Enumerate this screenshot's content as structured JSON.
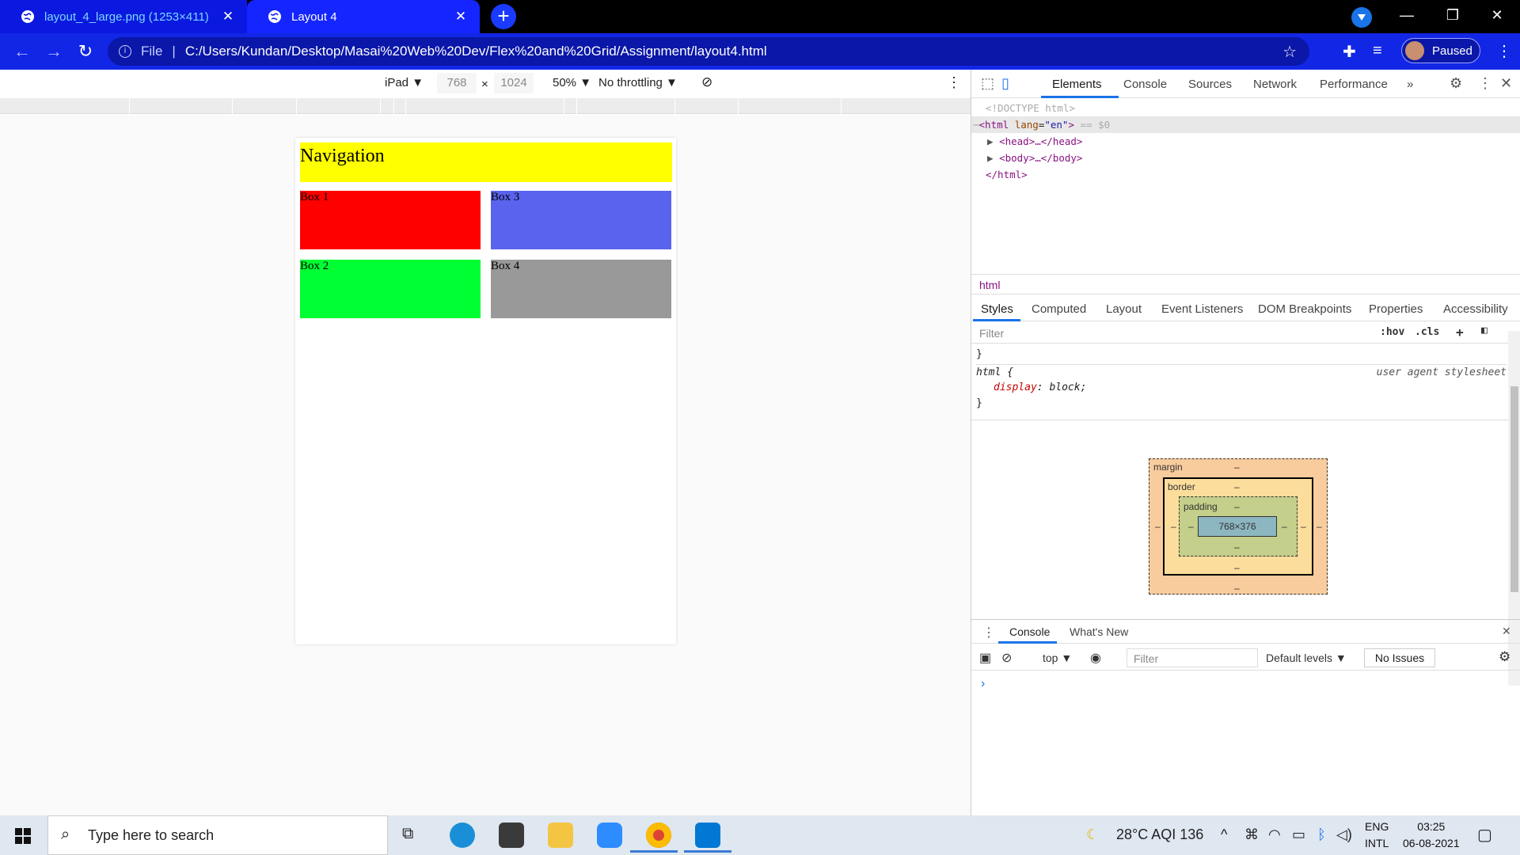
{
  "browser": {
    "tabs": [
      {
        "title": "layout_4_large.png (1253×411)",
        "active": false
      },
      {
        "title": "Layout 4",
        "active": true
      }
    ],
    "address": {
      "scheme_label": "File",
      "url": "C:/Users/Kundan/Desktop/Masai%20Web%20Dev/Flex%20and%20Grid/Assignment/layout4.html"
    },
    "profile_label": "Paused"
  },
  "device_toolbar": {
    "device": "iPad ▼",
    "width": "768",
    "times": "×",
    "height": "1024",
    "zoom": "50% ▼",
    "throttling": "No throttling ▼"
  },
  "page": {
    "nav_text": "Navigation",
    "boxes": [
      "Box 1",
      "Box 3",
      "Box 2",
      "Box 4"
    ],
    "colors": {
      "nav": "#ffff00",
      "box1": "#ff0000",
      "box3": "#5a63ee",
      "box2": "#00ff33",
      "box4": "#999999"
    }
  },
  "devtools": {
    "tabs": [
      "Elements",
      "Console",
      "Sources",
      "Network",
      "Performance",
      "»"
    ],
    "dom": {
      "doctype": "<!DOCTYPE html>",
      "html_open_tag": "<html",
      "lang_attr": "lang",
      "lang_value": "\"en\"",
      "selected_marker": "== $0",
      "head": "<head>…</head>",
      "body": "<body>…</body>",
      "html_close": "</html>"
    },
    "breadcrumb": "html",
    "style_tabs": [
      "Styles",
      "Computed",
      "Layout",
      "Event Listeners",
      "DOM Breakpoints",
      "Properties",
      "Accessibility"
    ],
    "filter_placeholder": "Filter",
    "filter_tools": [
      ":hov",
      ".cls",
      "+"
    ],
    "rules": {
      "close_brace": "}",
      "selector": "html {",
      "source": "user agent stylesheet",
      "property": "display",
      "value": "block;"
    },
    "box_model": {
      "margin_label": "margin",
      "border_label": "border",
      "padding_label": "padding",
      "dash": "–",
      "content_size": "768×376"
    },
    "drawer": {
      "tabs": [
        "Console",
        "What's New"
      ],
      "context": "top ▼",
      "filter_placeholder": "Filter",
      "levels": "Default levels ▼",
      "issues": "No Issues",
      "prompt": "›"
    }
  },
  "taskbar": {
    "search_placeholder": "Type here to search",
    "weather": "28°C  AQI 136",
    "lang_line1": "ENG",
    "lang_line2": "INTL",
    "time": "03:25",
    "date": "06-08-2021"
  }
}
